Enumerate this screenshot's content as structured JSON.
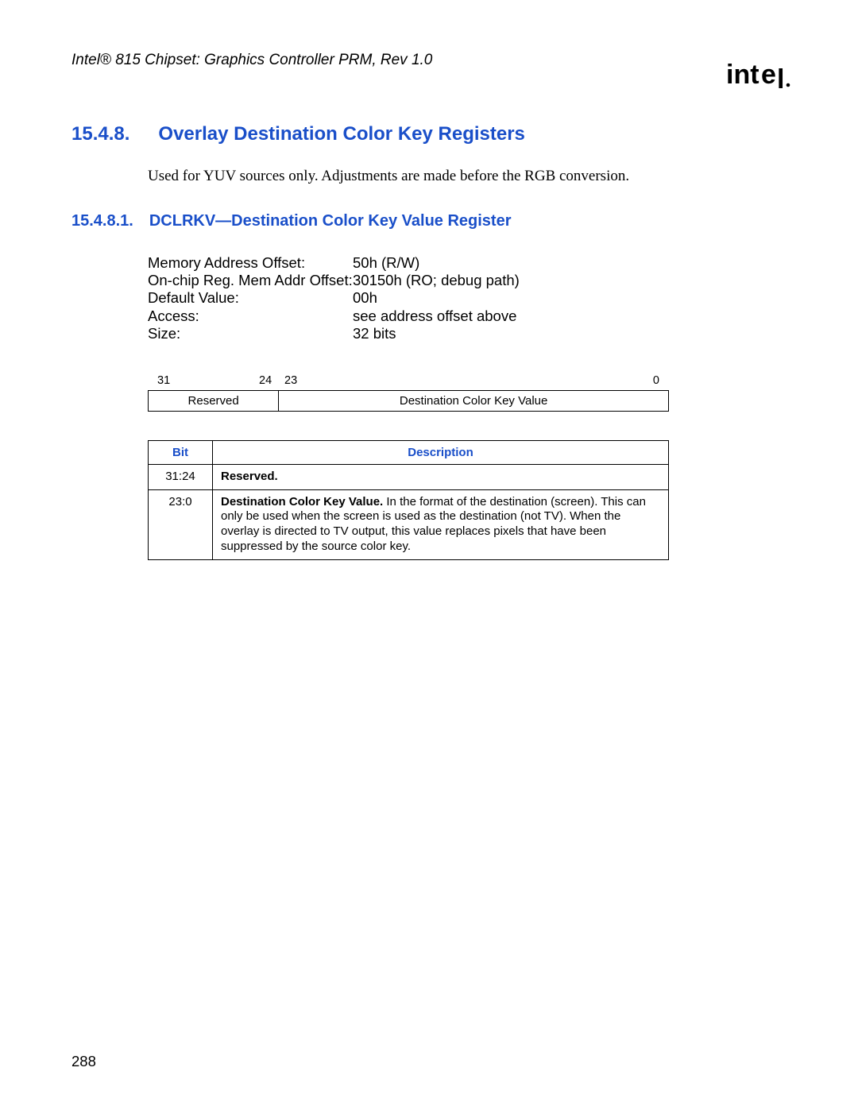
{
  "header": {
    "doc_title": "Intel® 815 Chipset: Graphics Controller PRM, Rev 1.0",
    "logo_name": "intel-logo"
  },
  "section": {
    "number": "15.4.8.",
    "title": "Overlay Destination Color Key Registers",
    "intro": "Used for YUV sources only. Adjustments are made before the RGB conversion."
  },
  "subsection": {
    "number": "15.4.8.1.",
    "title": "DCLRKV—Destination Color Key Value Register"
  },
  "properties": [
    {
      "label": "Memory Address Offset:",
      "value": "50h (R/W)"
    },
    {
      "label": "On-chip Reg. Mem Addr Offset:",
      "value": "30150h (RO; debug path)"
    },
    {
      "label": "Default Value:",
      "value": "00h"
    },
    {
      "label": "Access:",
      "value": "see address offset above"
    },
    {
      "label": "Size:",
      "value": "32 bits"
    }
  ],
  "bitfield": {
    "marks": {
      "b31": "31",
      "b24": "24",
      "b23": "23",
      "b0": "0"
    },
    "cells": [
      {
        "width": "25%",
        "label": "Reserved"
      },
      {
        "width": "75%",
        "label": "Destination Color Key Value"
      }
    ]
  },
  "desc_table": {
    "headers": {
      "bit": "Bit",
      "desc": "Description"
    },
    "rows": [
      {
        "bit": "31:24",
        "bold": "Reserved.",
        "rest": ""
      },
      {
        "bit": "23:0",
        "bold": "Destination Color Key Value.",
        "rest": " In the format of the destination (screen). This can only be used when the screen is used as the destination (not TV). When the overlay is directed to TV output, this value replaces pixels that have been suppressed by the source color key."
      }
    ]
  },
  "page_number": "288"
}
